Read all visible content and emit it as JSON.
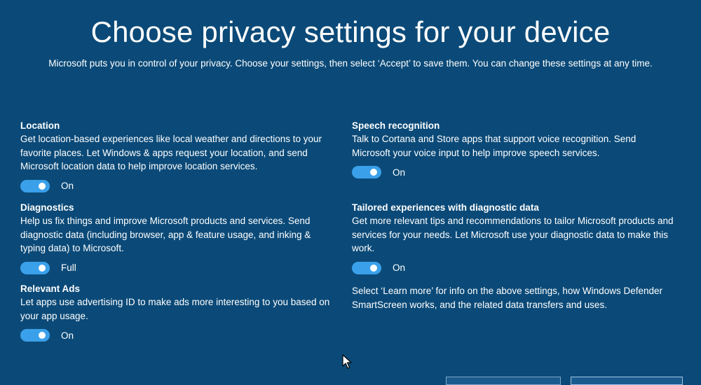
{
  "header": {
    "title": "Choose privacy settings for your device",
    "subtitle": "Microsoft puts you in control of your privacy. Choose your settings, then select ‘Accept’ to save them. You can change these settings at any time."
  },
  "settings": [
    {
      "title": "Location",
      "description": "Get location-based experiences like local weather and directions to your favorite places. Let Windows & apps request your location, and send Microsoft location data to help improve location services.",
      "state": "On"
    },
    {
      "title": "Diagnostics",
      "description": "Help us fix things and improve Microsoft products and services. Send diagnostic data (including browser, app & feature usage, and inking & typing data) to Microsoft.",
      "state": "Full"
    },
    {
      "title": "Relevant Ads",
      "description": "Let apps use advertising ID to make ads more interesting to you based on your app usage.",
      "state": "On"
    },
    {
      "title": "Speech recognition",
      "description": "Talk to Cortana and Store apps that support voice recognition. Send Microsoft your voice input to help improve speech services.",
      "state": "On"
    },
    {
      "title": "Tailored experiences with diagnostic data",
      "description": "Get more relevant tips and recommendations to tailor Microsoft products and services for your needs. Let Microsoft use your diagnostic data to make this work.",
      "state": "On"
    }
  ],
  "learn_more_note": "Select ‘Learn more’ for info on the above settings, how Windows Defender SmartScreen works, and the related data transfers and uses.",
  "colors": {
    "background": "#0b4a78",
    "toggle_on": "#3aa0ea",
    "text": "#ffffff"
  }
}
